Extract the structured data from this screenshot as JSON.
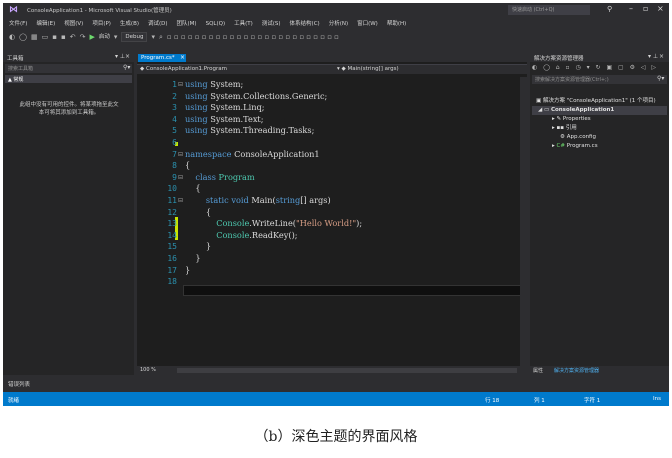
{
  "window": {
    "title": "ConsoleApplication1 - Microsoft Visual Studio(管理员)",
    "quick_launch_placeholder": "快速启动 (Ctrl+Q)"
  },
  "menu": [
    "文件(F)",
    "编辑(E)",
    "视图(V)",
    "项目(P)",
    "生成(B)",
    "调试(D)",
    "团队(M)",
    "SQL(Q)",
    "工具(T)",
    "测试(S)",
    "体系结构(C)",
    "分析(N)",
    "窗口(W)",
    "帮助(H)"
  ],
  "toolbar": {
    "start_label": "启动",
    "config": "Debug"
  },
  "toolbox": {
    "title": "工具箱",
    "search_placeholder": "搜索工具箱",
    "group": "▲ 常规",
    "empty_line1": "此组中没有可用的控件。将某项拖至此文",
    "empty_line2": "本可将其添加到工具箱。"
  },
  "editor": {
    "tab_label": "Program.cs*",
    "nav_class": "ConsoleApplication1.Program",
    "nav_member": "Main(string[] args)",
    "zoom": "100 %",
    "lines": [
      "using System;",
      "using System.Collections.Generic;",
      "using System.Linq;",
      "using System.Text;",
      "using System.Threading.Tasks;",
      "",
      "namespace ConsoleApplication1",
      "{",
      "    class Program",
      "    {",
      "        static void Main(string[] args)",
      "        {",
      "            Console.WriteLine(\"Hello World!\");",
      "            Console.ReadKey();",
      "        }",
      "    }",
      "}",
      ""
    ]
  },
  "solution_explorer": {
    "title": "解决方案资源管理器",
    "search_placeholder": "搜索解决方案资源管理器(Ctrl+;)",
    "solution_label": "解决方案 \"ConsoleApplication1\" (1 个项目)",
    "project": "ConsoleApplication1",
    "items": [
      "Properties",
      "引用",
      "App.config",
      "Program.cs"
    ],
    "tab_properties": "属性",
    "tab_solution": "解决方案资源管理器"
  },
  "error_list": "错误列表",
  "status": {
    "ready": "就绪",
    "row": "行 18",
    "col": "列 1",
    "char": "字符 1",
    "mode": "Ins"
  },
  "caption": "（b）深色主题的界面风格"
}
